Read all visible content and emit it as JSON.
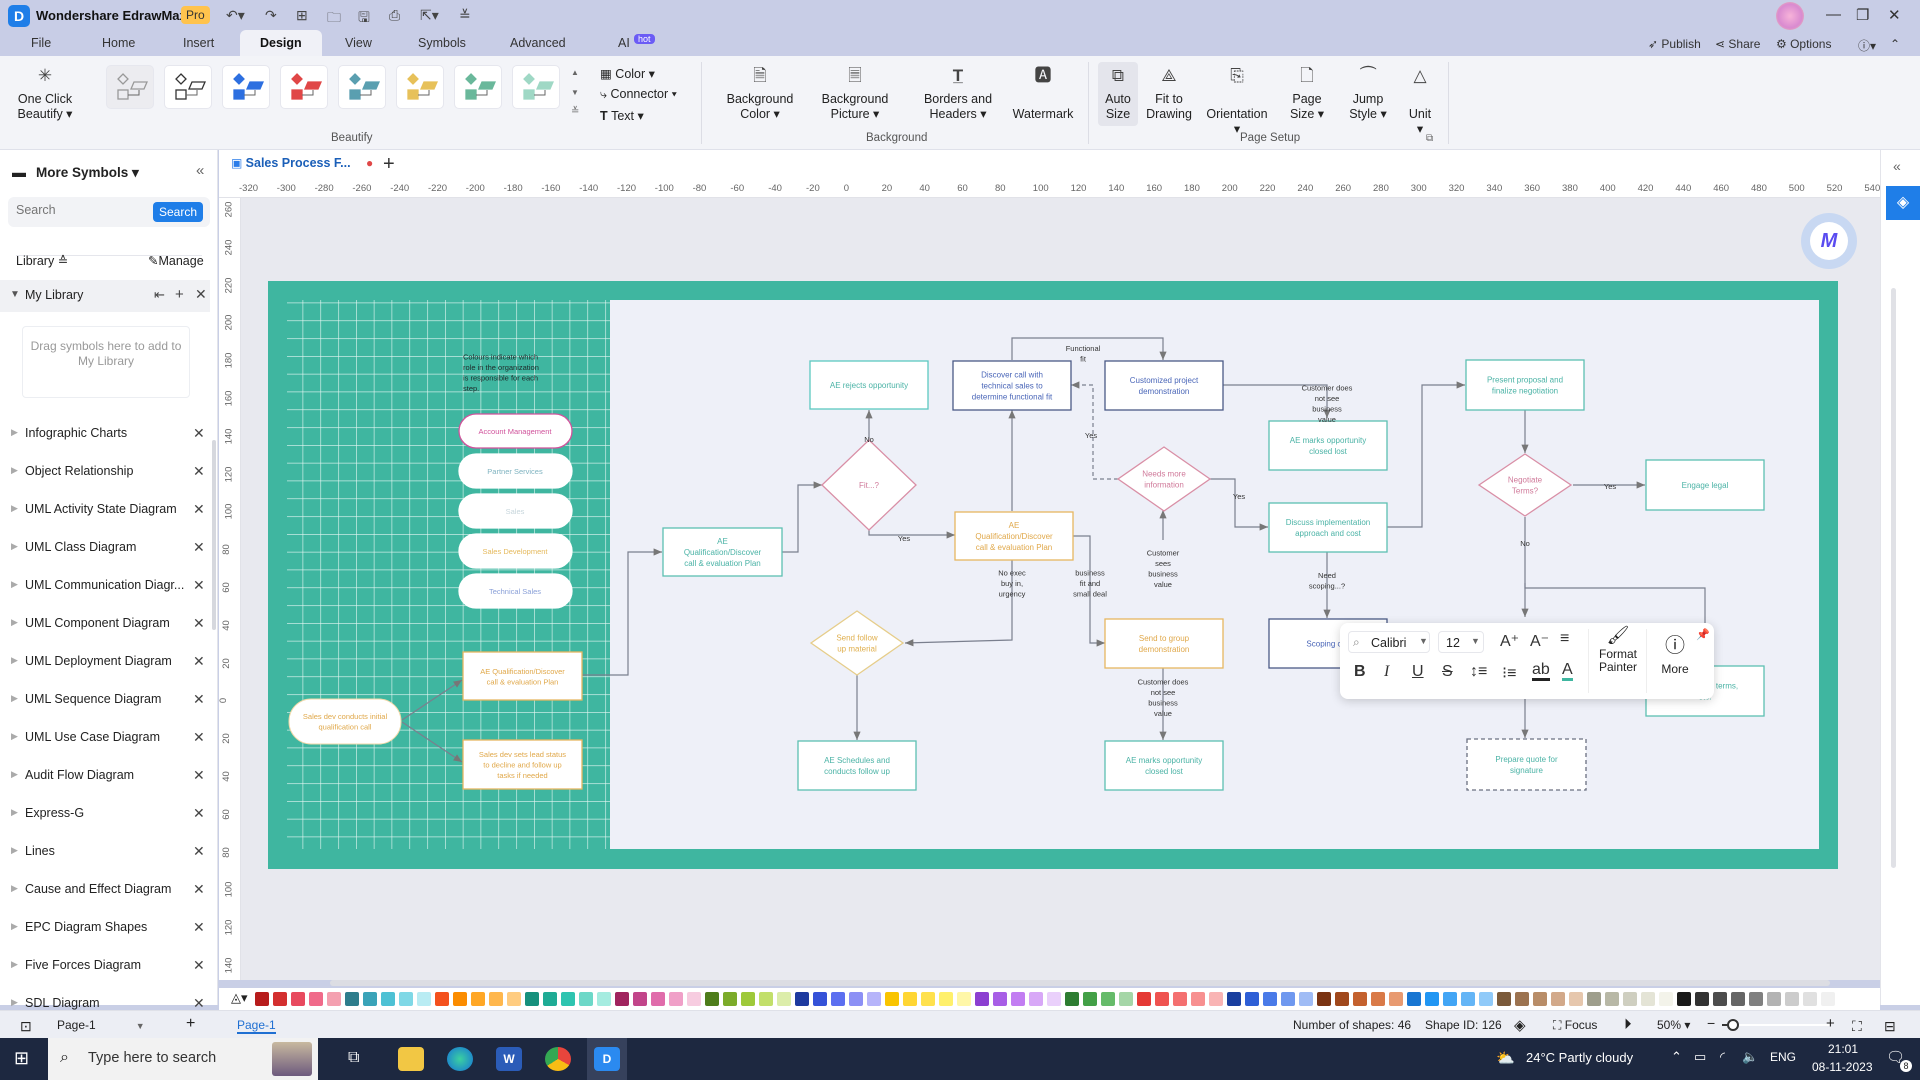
{
  "app": {
    "title": "Wondershare EdrawMax",
    "badge": "Pro",
    "window_controls": [
      "minimize",
      "restore",
      "close"
    ]
  },
  "quick_access": [
    "undo-icon",
    "redo-icon",
    "new-icon",
    "open-icon",
    "save-icon",
    "print-icon",
    "export-icon",
    "customize-icon"
  ],
  "menu": {
    "tabs": [
      {
        "label": "File"
      },
      {
        "label": "Home"
      },
      {
        "label": "Insert"
      },
      {
        "label": "Design",
        "active": true
      },
      {
        "label": "View"
      },
      {
        "label": "Symbols"
      },
      {
        "label": "Advanced"
      },
      {
        "label": "AI"
      }
    ],
    "ai_badge": "hot",
    "right": {
      "publish": "Publish",
      "share": "Share",
      "options": "Options"
    }
  },
  "ribbon": {
    "one_click": {
      "line1": "One Click",
      "line2": "Beautify"
    },
    "beautify_label": "Beautify",
    "style_options": {
      "color": "Color",
      "connector": "Connector",
      "text": "Text"
    },
    "background": [
      {
        "line1": "Background",
        "line2": "Color"
      },
      {
        "line1": "Background",
        "line2": "Picture"
      },
      {
        "line1": "Borders and",
        "line2": "Headers"
      },
      {
        "line1": "Watermark",
        "line2": ""
      }
    ],
    "background_label": "Background",
    "page_setup": [
      {
        "line1": "Auto",
        "line2": "Size"
      },
      {
        "line1": "Fit to",
        "line2": "Drawing"
      },
      {
        "line1": "Orientation",
        "line2": ""
      },
      {
        "line1": "Page",
        "line2": "Size"
      },
      {
        "line1": "Jump",
        "line2": "Style"
      },
      {
        "line1": "Unit",
        "line2": ""
      }
    ],
    "page_setup_label": "Page Setup",
    "theme_colors": [
      "#cfd3dc",
      "#333333",
      "#2d6fe0",
      "#e04747",
      "#5a9fb0",
      "#e7c15a",
      "#6ab89b",
      "#9fd8c5"
    ]
  },
  "sidebar": {
    "title": "More Symbols",
    "search_placeholder": "Search",
    "search_button": "Search",
    "library_label": "Library",
    "manage_label": "Manage",
    "my_library": "My Library",
    "drop_hint": "Drag symbols here to add to My Library",
    "libraries": [
      "Infographic Charts",
      "Object Relationship",
      "UML Activity State Diagram",
      "UML Class Diagram",
      "UML Communication Diagr...",
      "UML Component Diagram",
      "UML Deployment Diagram",
      "UML Sequence Diagram",
      "UML Use Case Diagram",
      "Audit Flow Diagram",
      "Express-G",
      "Lines",
      "Cause and Effect Diagram",
      "EPC Diagram Shapes",
      "Five Forces Diagram",
      "SDL Diagram"
    ]
  },
  "document": {
    "tab_title": "Sales Process F...",
    "ruler_h": [
      "-320",
      "-300",
      "-280",
      "-260",
      "-240",
      "-220",
      "-200",
      "-180",
      "-160",
      "-140",
      "-120",
      "-100",
      "-80",
      "-60",
      "-40",
      "-20",
      "0",
      "20",
      "40",
      "60",
      "80",
      "100",
      "120",
      "140",
      "160",
      "180",
      "200",
      "220",
      "240",
      "260",
      "280",
      "300",
      "320",
      "340",
      "360",
      "380",
      "400",
      "420",
      "440",
      "460",
      "480",
      "500",
      "520",
      "540"
    ],
    "ruler_v": [
      "260",
      "240",
      "220",
      "200",
      "180",
      "160",
      "140",
      "120",
      "100",
      "80",
      "60",
      "40",
      "20",
      "0",
      "20",
      "40",
      "60",
      "80",
      "100",
      "120",
      "140"
    ]
  },
  "diagram": {
    "legend_note": "Colours indicate which role in the organization is responsible for each step.",
    "legend": [
      {
        "label": "Account Management",
        "color": "#d0529b"
      },
      {
        "label": "Partner Services",
        "color": "#7fb3c0"
      },
      {
        "label": "Sales",
        "color": "#c7d6dc"
      },
      {
        "label": "Sales Development",
        "color": "#e5b95c"
      },
      {
        "label": "Technical Sales",
        "color": "#8aa0d8"
      }
    ],
    "nodes": {
      "sdr_call": "Sales dev conducts initial qualification call",
      "ae_qual_left": "AE Qualification/Discover call & evaluation Plan",
      "sdr_lead": "Sales dev sets lead status to decline and follow up tasks if needed",
      "ae_qual_teal": "AE Qualification/Discover call & evaluation Plan",
      "fit": "Fit...?",
      "ae_rejects": "AE rejects opportunity",
      "discover_tech": "Discover call with technical sales to determine functional fit",
      "ae_qual_orange": "AE Qualification/Discover call & evaluation Plan",
      "custom_demo": "Customized project demonstration",
      "needs_info": "Needs more information",
      "send_followup": "Send follow up material",
      "ae_schedules": "AE Schedules and conducts follow up",
      "group_demo": "Send to group demonstration",
      "ae_closed_1": "AE marks opportunity closed lost",
      "ae_closed_2": "AE marks opportunity closed lost",
      "discuss_impl": "Discuss implementation approach and cost",
      "scoping": "Scoping call",
      "present_proposal": "Present proposal and finalize negotiation",
      "negotiate": "Negotiate Terms?",
      "engage_legal": "Engage legal",
      "missing_terms": "...is missing terms, etc.",
      "prepare_quote": "Prepare quote for signature"
    },
    "edge_labels": {
      "functional_fit": "Functional fit",
      "no": "No",
      "yes": "Yes",
      "no_exec": "No exec buy in, urgency",
      "biz_fit": "business fit and small deal",
      "cust_sees": "Customer sees business value",
      "cust_not_sees": "Customer does not see business value",
      "need_scoping": "Need scoping...?"
    }
  },
  "format_popup": {
    "font": "Calibri",
    "size": "12",
    "format_painter": "Format Painter",
    "more": "More"
  },
  "palette": [
    "#b71c1c",
    "#d32f2f",
    "#e84a5f",
    "#f06a8a",
    "#f4a0b0",
    "#2e7d8c",
    "#3aa3b8",
    "#4ec1d4",
    "#7fd8e6",
    "#b9ecf3",
    "#f4511e",
    "#fb8c00",
    "#ffa726",
    "#ffb74d",
    "#ffcc80",
    "#16907c",
    "#1fab95",
    "#2ec4b0",
    "#6dd8c8",
    "#a5ece0",
    "#a0245e",
    "#c2458a",
    "#e06cab",
    "#f0a0c8",
    "#f7cce0",
    "#4e7d1b",
    "#7cab2a",
    "#9ec93a",
    "#c2df6a",
    "#dcedaa",
    "#1e3a9f",
    "#3552d8",
    "#5c6ff0",
    "#8c90f5",
    "#b6b4fa",
    "#f9c400",
    "#ffd633",
    "#ffe14d",
    "#fff06b",
    "#fff7a8",
    "#8c3fd1",
    "#a85ee6",
    "#c27df2",
    "#d8a8f7",
    "#ead0fb",
    "#2e7d32",
    "#43a047",
    "#66bb6a",
    "#a5d6a7",
    "#e53935",
    "#ef5350",
    "#f47070",
    "#f79090",
    "#f9b4b4",
    "#1a3f9f",
    "#2e5fd6",
    "#4a7ae8",
    "#6f98ef",
    "#a0bcf5",
    "#7a3312",
    "#a0481c",
    "#c4612e",
    "#d97a48",
    "#e89a70",
    "#1976d2",
    "#2196f3",
    "#42a5f5",
    "#64b5f6",
    "#90caf9",
    "#7b5a3a",
    "#9c7350",
    "#b88d68",
    "#d2a98a",
    "#e6c7ad",
    "#9e9e8c",
    "#b8b8a6",
    "#cfcfc0",
    "#e4e4d6",
    "#f3f3ea",
    "#1a1a1a",
    "#333333",
    "#4d4d4d",
    "#666666",
    "#808080",
    "#b3b3b3",
    "#cccccc",
    "#e0e0e0",
    "#f0f0f0",
    "#ffffff"
  ],
  "page_bar": {
    "page_select": "Page-1",
    "page_tab": "Page-1"
  },
  "status": {
    "shapes": "Number of shapes: 46",
    "shape_id": "Shape ID: 126",
    "focus": "Focus",
    "zoom": "50%",
    "zoom_fraction": 0.1
  },
  "taskbar": {
    "search_placeholder": "Type here to search",
    "weather": "24°C  Partly cloudy",
    "lang": "ENG",
    "time": "21:01",
    "date": "08-11-2023",
    "notifications": "8"
  }
}
